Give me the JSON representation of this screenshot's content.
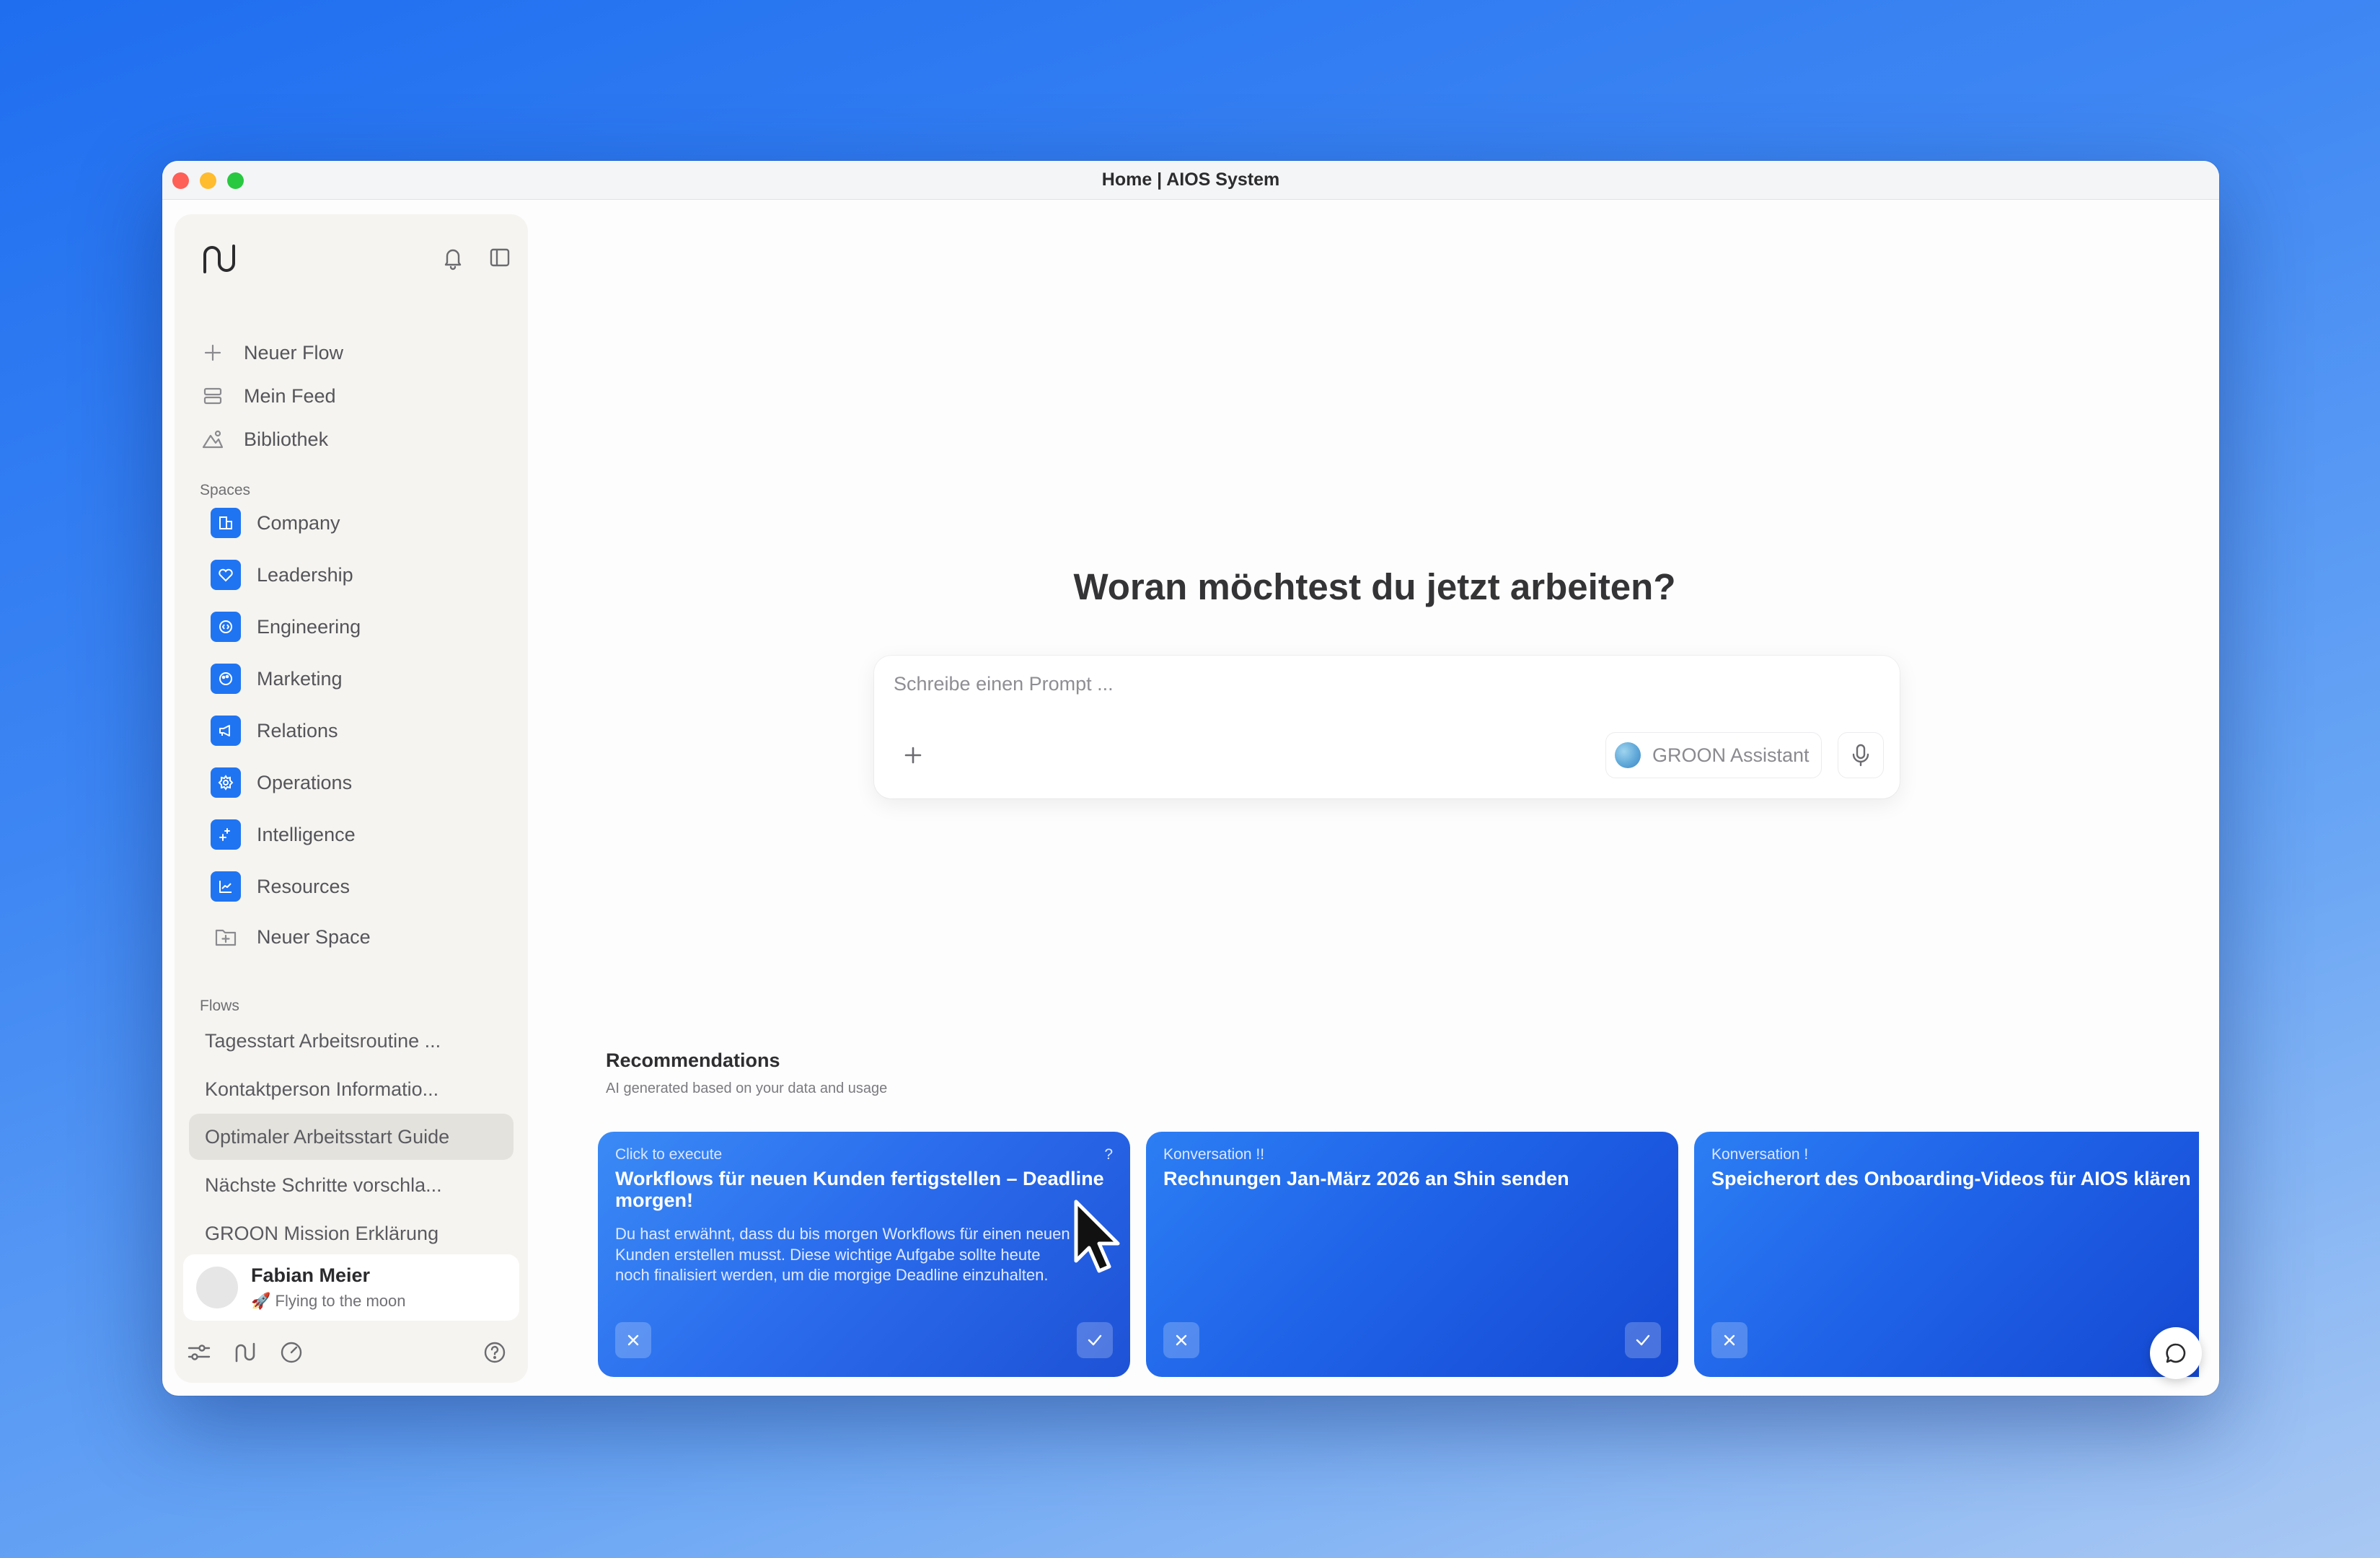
{
  "window": {
    "title": "Home | AIOS System"
  },
  "sidebar": {
    "nav": [
      {
        "label": "Neuer Flow",
        "icon": "plus-icon"
      },
      {
        "label": "Mein Feed",
        "icon": "feed-icon"
      },
      {
        "label": "Bibliothek",
        "icon": "library-icon"
      }
    ],
    "spaces_label": "Spaces",
    "spaces": [
      {
        "label": "Company",
        "icon": "building-icon"
      },
      {
        "label": "Leadership",
        "icon": "heart-icon"
      },
      {
        "label": "Engineering",
        "icon": "code-icon"
      },
      {
        "label": "Marketing",
        "icon": "palette-icon"
      },
      {
        "label": "Relations",
        "icon": "megaphone-icon"
      },
      {
        "label": "Operations",
        "icon": "gear-icon"
      },
      {
        "label": "Intelligence",
        "icon": "sparkles-icon"
      },
      {
        "label": "Resources",
        "icon": "chart-icon"
      },
      {
        "label": "Neuer Space",
        "icon": "folder-plus-icon"
      }
    ],
    "flows_label": "Flows",
    "flows": [
      {
        "label": "Tagesstart Arbeitsroutine ..."
      },
      {
        "label": "Kontaktperson Informatio..."
      },
      {
        "label": "Optimaler Arbeitsstart Guide",
        "active": true
      },
      {
        "label": "Nächste Schritte vorschla..."
      },
      {
        "label": "GROON Mission Erklärung"
      }
    ],
    "user": {
      "name": "Fabian Meier",
      "status": "🚀 Flying to the moon"
    }
  },
  "main": {
    "headline": "Woran möchtest du jetzt arbeiten?",
    "prompt": {
      "placeholder": "Schreibe einen Prompt ...",
      "assistant": "GROON Assistant"
    },
    "recommendations": {
      "title": "Recommendations",
      "subtitle": "AI generated based on your data and usage",
      "cards": [
        {
          "type": "Click to execute",
          "marker": "?",
          "title": "Workflows für neuen Kunden fertigstellen – Deadline morgen!",
          "description": "Du hast erwähnt, dass du bis morgen Workflows für einen neuen Kunden erstellen musst. Diese wichtige Aufgabe sollte heute noch finalisiert werden, um die morgige Deadline einzuhalten."
        },
        {
          "type": "Konversation !!",
          "title": "Rechnungen Jan-März 2026 an Shin senden",
          "description": ""
        },
        {
          "type": "Konversation !",
          "title": "Speicherort des Onboarding-Videos für AIOS klären",
          "description": ""
        }
      ]
    }
  },
  "colors": {
    "accent": "#1f74f2",
    "background_top": "#1f6ef0",
    "card_blue": "#1f63e8"
  }
}
